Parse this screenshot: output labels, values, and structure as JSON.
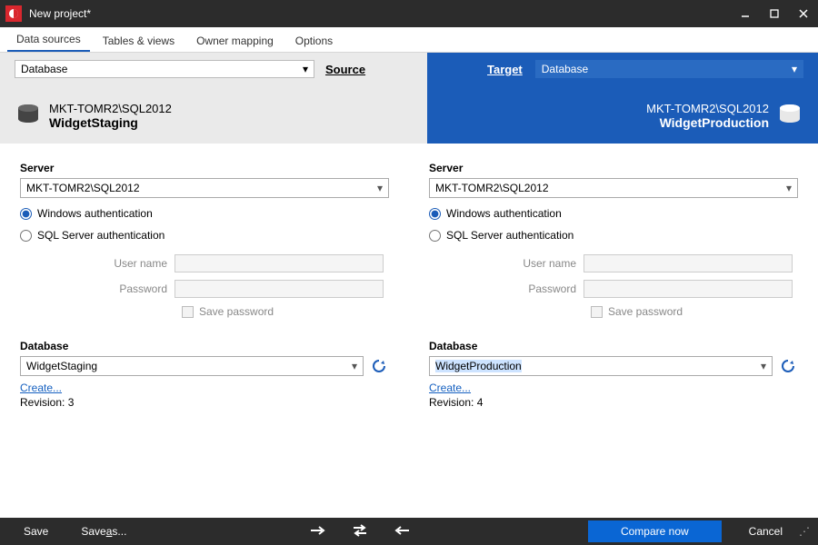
{
  "window": {
    "title": "New project*"
  },
  "tabs": [
    "Data sources",
    "Tables & views",
    "Owner mapping",
    "Options"
  ],
  "active_tab_index": 0,
  "band": {
    "source": {
      "type_label": "Database",
      "heading": "Source",
      "server": "MKT-TOMR2\\SQL2012",
      "database": "WidgetStaging"
    },
    "target": {
      "heading": "Target",
      "type_label": "Database",
      "server": "MKT-TOMR2\\SQL2012",
      "database": "WidgetProduction"
    }
  },
  "form": {
    "labels": {
      "server": "Server",
      "windows_auth": "Windows authentication",
      "sql_auth": "SQL Server authentication",
      "user_name": "User name",
      "password": "Password",
      "save_password": "Save password",
      "database": "Database",
      "create": "Create...",
      "revision_prefix": "Revision: "
    },
    "source": {
      "server_value": "MKT-TOMR2\\SQL2012",
      "auth_mode": "windows",
      "database_value": "WidgetStaging",
      "revision": "3"
    },
    "target": {
      "server_value": "MKT-TOMR2\\SQL2012",
      "auth_mode": "windows",
      "database_value": "WidgetProduction",
      "revision": "4"
    }
  },
  "footer": {
    "save": "Save",
    "save_as_pre": "Save ",
    "save_as_key": "a",
    "save_as_post": "s...",
    "compare": "Compare now",
    "cancel": "Cancel"
  }
}
